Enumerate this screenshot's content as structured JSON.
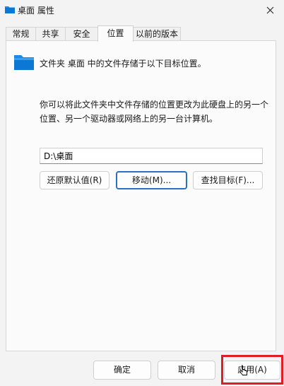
{
  "window": {
    "title": "桌面 属性",
    "icon": "folder-icon"
  },
  "tabs": [
    {
      "label": "常规",
      "active": false
    },
    {
      "label": "共享",
      "active": false
    },
    {
      "label": "安全",
      "active": false
    },
    {
      "label": "位置",
      "active": true
    },
    {
      "label": "以前的版本",
      "active": false
    }
  ],
  "location": {
    "header": "文件夹 桌面 中的文件存储于以下目标位置。",
    "description": "你可以将此文件夹中文件存储的位置更改为此硬盘上的另一个位置、另一个驱动器或网络上的另一台计算机。",
    "path_value": "D:\\桌面",
    "restore_label": "还原默认值(R)",
    "move_label": "移动(M)...",
    "find_target_label": "查找目标(F)..."
  },
  "footer": {
    "ok_label": "确定",
    "cancel_label": "取消",
    "apply_label": "应用(A)"
  },
  "colors": {
    "accent": "#2f6fbd",
    "highlight": "#e21c23",
    "folder": "#0a78d4"
  }
}
